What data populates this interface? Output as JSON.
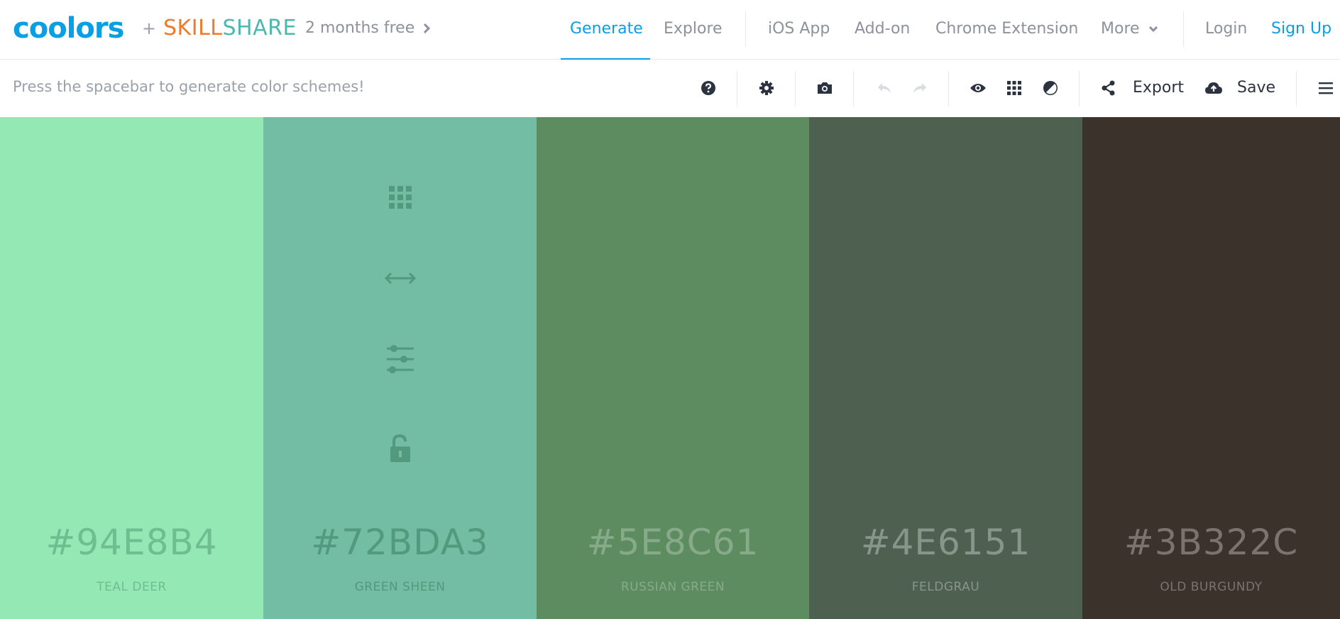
{
  "nav": {
    "logo": "coolors",
    "plus": "+",
    "skillshare_a": "SKILL",
    "skillshare_b": "SHARE",
    "promo": "2 months free",
    "links": {
      "generate": "Generate",
      "explore": "Explore",
      "ios": "iOS App",
      "addon": "Add-on",
      "chrome": "Chrome Extension",
      "more": "More",
      "login": "Login",
      "signup": "Sign Up"
    },
    "accent_color": "#0a9ee4"
  },
  "toolbar": {
    "hint": "Press the spacebar to generate color schemes!",
    "export_label": "Export",
    "save_label": "Save",
    "icons": [
      "help-icon",
      "settings-icon",
      "camera-icon",
      "undo-icon",
      "redo-icon",
      "eye-icon",
      "grid-icon",
      "contrast-icon",
      "share-icon",
      "upload-cloud-icon",
      "menu-icon"
    ]
  },
  "palette": {
    "swatches": [
      {
        "hex": "#94E8B4",
        "name": "TEAL DEER",
        "color": "#94e8b4",
        "text_color": "#6dbf8f"
      },
      {
        "hex": "#72BDA3",
        "name": "GREEN SHEEN",
        "color": "#72bda3",
        "text_color": "#52997f"
      },
      {
        "hex": "#5E8C61",
        "name": "RUSSIAN GREEN",
        "color": "#5e8c61",
        "text_color": "#87ab89"
      },
      {
        "hex": "#4E6151",
        "name": "FELDGRAU",
        "color": "#4e6151",
        "text_color": "#86978a"
      },
      {
        "hex": "#3B322C",
        "name": "OLD BURGUNDY",
        "color": "#3b322c",
        "text_color": "#7b736d"
      }
    ],
    "hover_tools": [
      "grid-icon",
      "drag-arrows-icon",
      "adjust-sliders-icon",
      "unlock-icon"
    ]
  }
}
